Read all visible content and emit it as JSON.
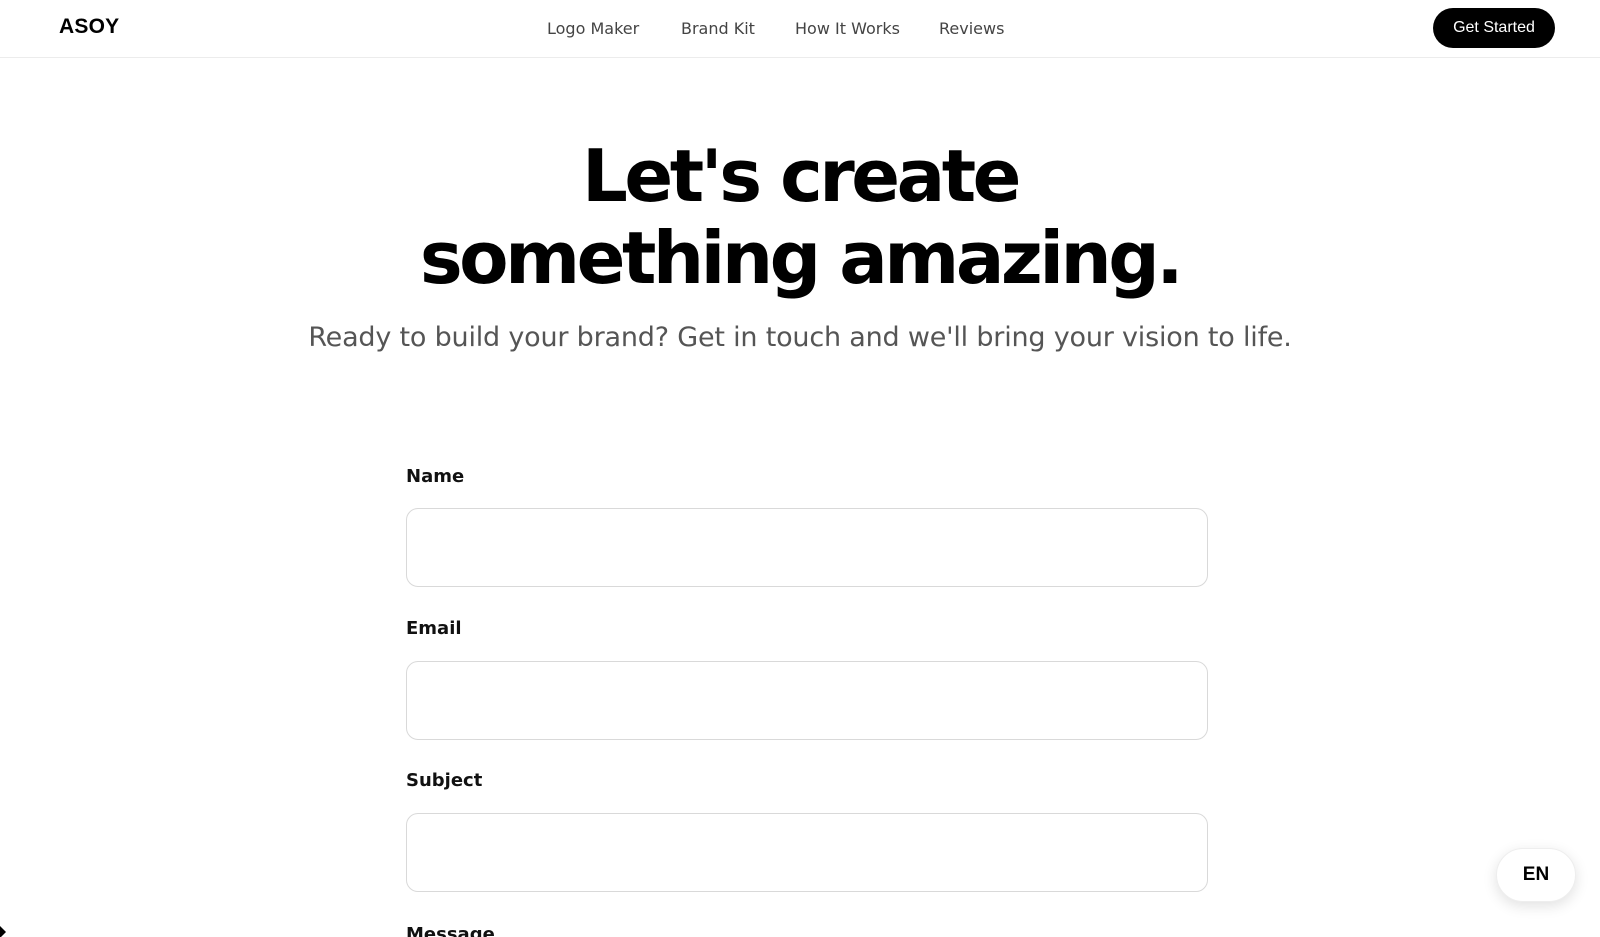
{
  "header": {
    "logo": "ASOY",
    "nav": [
      "Logo Maker",
      "Brand Kit",
      "How It Works",
      "Reviews"
    ],
    "cta_label": "Get Started"
  },
  "hero": {
    "title_line1": "Let's create",
    "title_line2": "something amazing.",
    "subtitle": "Ready to build your brand? Get in touch and we'll bring your vision to life."
  },
  "form": {
    "name_label": "Name",
    "name_value": "",
    "email_label": "Email",
    "email_value": "",
    "subject_label": "Subject",
    "subject_value": "",
    "message_label": "Message"
  },
  "language": "EN"
}
